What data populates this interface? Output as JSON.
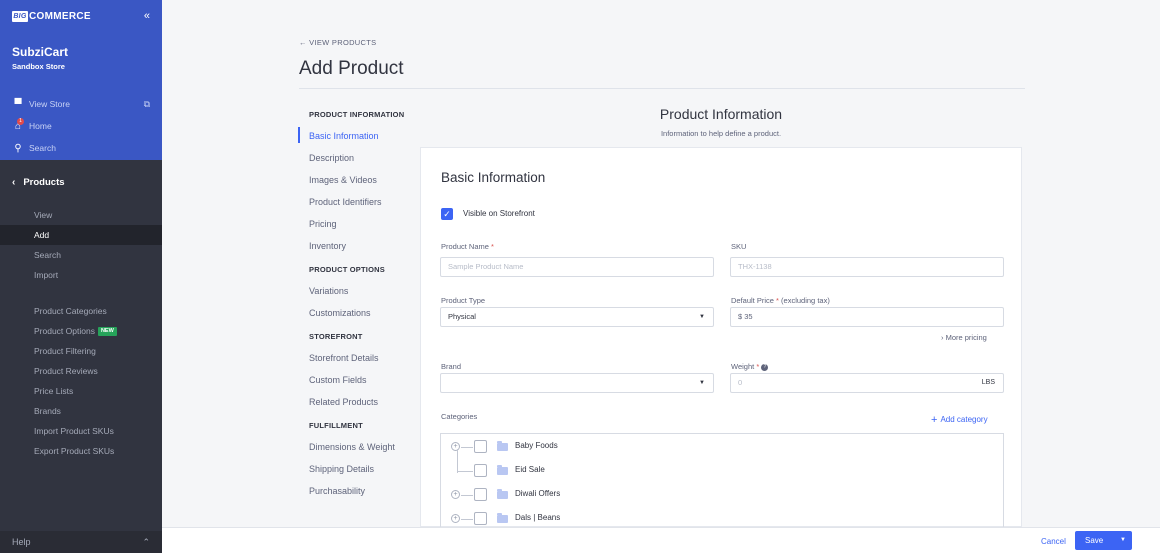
{
  "sidebar": {
    "brand": "COMMERCE",
    "brand_mark": "BIG",
    "store_name": "SubziCart",
    "store_sub": "Sandbox Store",
    "view_store": "View Store",
    "home": "Home",
    "home_badge": "1",
    "search": "Search",
    "section": "Products",
    "items": [
      "View",
      "Add",
      "Search",
      "Import"
    ],
    "items2": [
      "Product Categories",
      "Product Options",
      "Product Filtering",
      "Product Reviews",
      "Price Lists",
      "Brands",
      "Import Product SKUs",
      "Export Product SKUs"
    ],
    "new_badge": "NEW",
    "help": "Help"
  },
  "header": {
    "back": "← VIEW PRODUCTS",
    "title": "Add Product"
  },
  "nav": {
    "g1": "PRODUCT INFORMATION",
    "g1_items": [
      "Basic Information",
      "Description",
      "Images & Videos",
      "Product Identifiers",
      "Pricing",
      "Inventory"
    ],
    "g2": "PRODUCT OPTIONS",
    "g2_items": [
      "Variations",
      "Customizations"
    ],
    "g3": "STOREFRONT",
    "g3_items": [
      "Storefront Details",
      "Custom Fields",
      "Related Products"
    ],
    "g4": "FULFILLMENT",
    "g4_items": [
      "Dimensions & Weight",
      "Shipping Details",
      "Purchasability"
    ]
  },
  "main": {
    "section_title": "Product Information",
    "section_sub": "Information to help define a product.",
    "card_title": "Basic Information",
    "visible_label": "Visible on Storefront",
    "product_name_label": "Product Name",
    "product_name_placeholder": "Sample Product Name",
    "sku_label": "SKU",
    "sku_placeholder": "THX-1138",
    "product_type_label": "Product Type",
    "product_type_value": "Physical",
    "default_price_label": "Default Price",
    "default_price_suffix": "(excluding tax)",
    "default_price_value": "$ 35",
    "more_pricing": "› More pricing",
    "brand_label": "Brand",
    "brand_value": "",
    "weight_label": "Weight",
    "weight_placeholder": "0",
    "weight_unit": "LBS",
    "categories_label": "Categories",
    "add_category": "Add category",
    "categories": [
      "Baby Foods",
      "Eid Sale",
      "Diwali Offers",
      "Dals | Beans"
    ]
  },
  "footer": {
    "cancel": "Cancel",
    "save": "Save"
  },
  "colors": {
    "accent": "#3c64f4",
    "sidebar_top": "#3a57c4",
    "sidebar": "#313440"
  }
}
